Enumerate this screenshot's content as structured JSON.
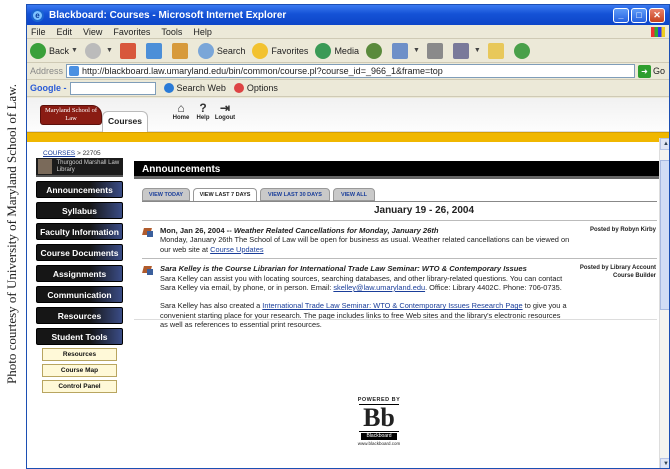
{
  "caption": "Photo courtesy of University of Maryland School of Law.",
  "window": {
    "title": "Blackboard: Courses - Microsoft Internet Explorer",
    "min": "_",
    "max": "□",
    "close": "✕"
  },
  "menu": [
    "File",
    "Edit",
    "View",
    "Favorites",
    "Tools",
    "Help"
  ],
  "toolbar": {
    "back": "Back",
    "search": "Search",
    "favorites": "Favorites",
    "media": "Media"
  },
  "address": {
    "label": "Address",
    "url": "http://blackboard.law.umaryland.edu/bin/common/course.pl?course_id=_966_1&frame=top",
    "go": "Go"
  },
  "google": {
    "logo": "Google -",
    "search_web": "Search Web",
    "options": "Options"
  },
  "bb": {
    "logo": "Maryland School of Law",
    "courses_tab": "Courses",
    "icons": [
      {
        "label": "Home",
        "icon": "house-icon"
      },
      {
        "label": "Help",
        "icon": "help-icon"
      },
      {
        "label": "Logout",
        "icon": "logout-icon"
      }
    ],
    "breadcrumb_link": "COURSES",
    "breadcrumb_rest": "> 22705"
  },
  "nav": {
    "library": "Thurgood Marshall Law Library",
    "buttons": [
      "Announcements",
      "Syllabus",
      "Faculty Information",
      "Course Documents",
      "Assignments",
      "Communication",
      "Resources",
      "Student Tools"
    ],
    "sub": [
      "Resources",
      "Course Map",
      "Control Panel"
    ]
  },
  "main": {
    "heading": "Announcements",
    "tabs": [
      {
        "label": "VIEW TODAY",
        "active": false
      },
      {
        "label": "VIEW LAST 7 DAYS",
        "active": true
      },
      {
        "label": "VIEW LAST 30 DAYS",
        "active": false
      },
      {
        "label": "VIEW ALL",
        "active": false
      }
    ],
    "range": "January 19 - 26, 2004",
    "announcements": [
      {
        "title_date": "Mon, Jan 26, 2004 -- ",
        "title": "Weather Related Cancellations for Monday, January 26th",
        "text": "Monday, January 26th The School of Law will be open for business as usual. Weather related cancellations can be viewed on our web site at ",
        "link": "Course Updates",
        "posted": "Posted by Robyn Kirby"
      },
      {
        "title": "Sara Kelley is the Course Librarian for International Trade Law Seminar: WTO & Contemporary Issues",
        "text1": "Sara Kelley can assist you with locating sources, searching databases, and other library-related questions. You can contact Sara Kelley via email, by phone, or in person. Email: ",
        "email": "skelley@law.umaryland.edu",
        "text2": ". Office: Library 4402C. Phone: 706-0735.",
        "text3": "Sara Kelley has also created a ",
        "link": "International Trade Law Seminar: WTO & Contemporary Issues Research Page",
        "text4": " to give you a convenient starting place for your research. The page includes links to free Web sites and the library's electronic resources as well as references to essential print resources.",
        "posted": "Posted by Library Account Course Builder"
      }
    ],
    "powered": {
      "by": "POWERED BY",
      "logo": "Bb",
      "brand": "Blackboard",
      "url": "www.blackboard.com"
    }
  },
  "colors": {
    "title_bar": "#1452d6",
    "accent_gold": "#f0b700",
    "heading_black": "#000000",
    "link": "#1a3e9a"
  }
}
